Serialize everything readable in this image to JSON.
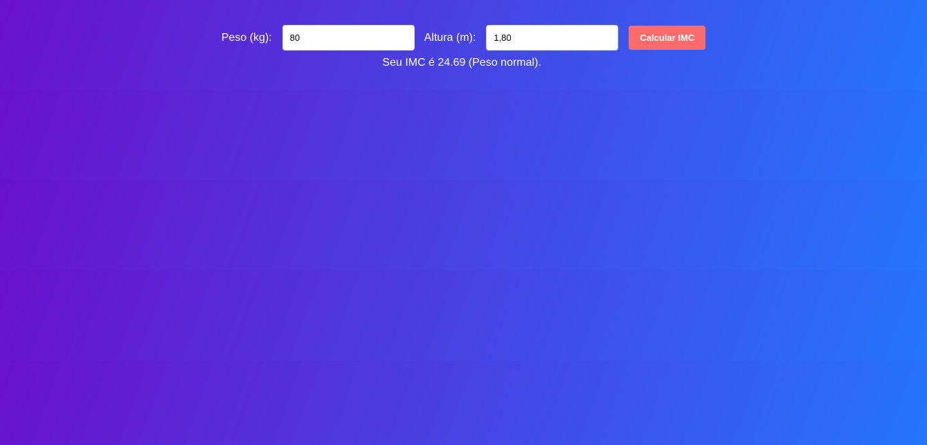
{
  "theme": {
    "gradient_start": "#6a11cb",
    "gradient_end": "#2575fc",
    "button_color": "#ff6b6b",
    "text_color": "#ffffff"
  },
  "form": {
    "weight_label": "Peso (kg):",
    "weight_value": "80",
    "height_label": "Altura (m):",
    "height_value": "1,80",
    "calculate_label": "Calcular IMC"
  },
  "result": {
    "text": "Seu IMC é 24.69 (Peso normal)."
  }
}
